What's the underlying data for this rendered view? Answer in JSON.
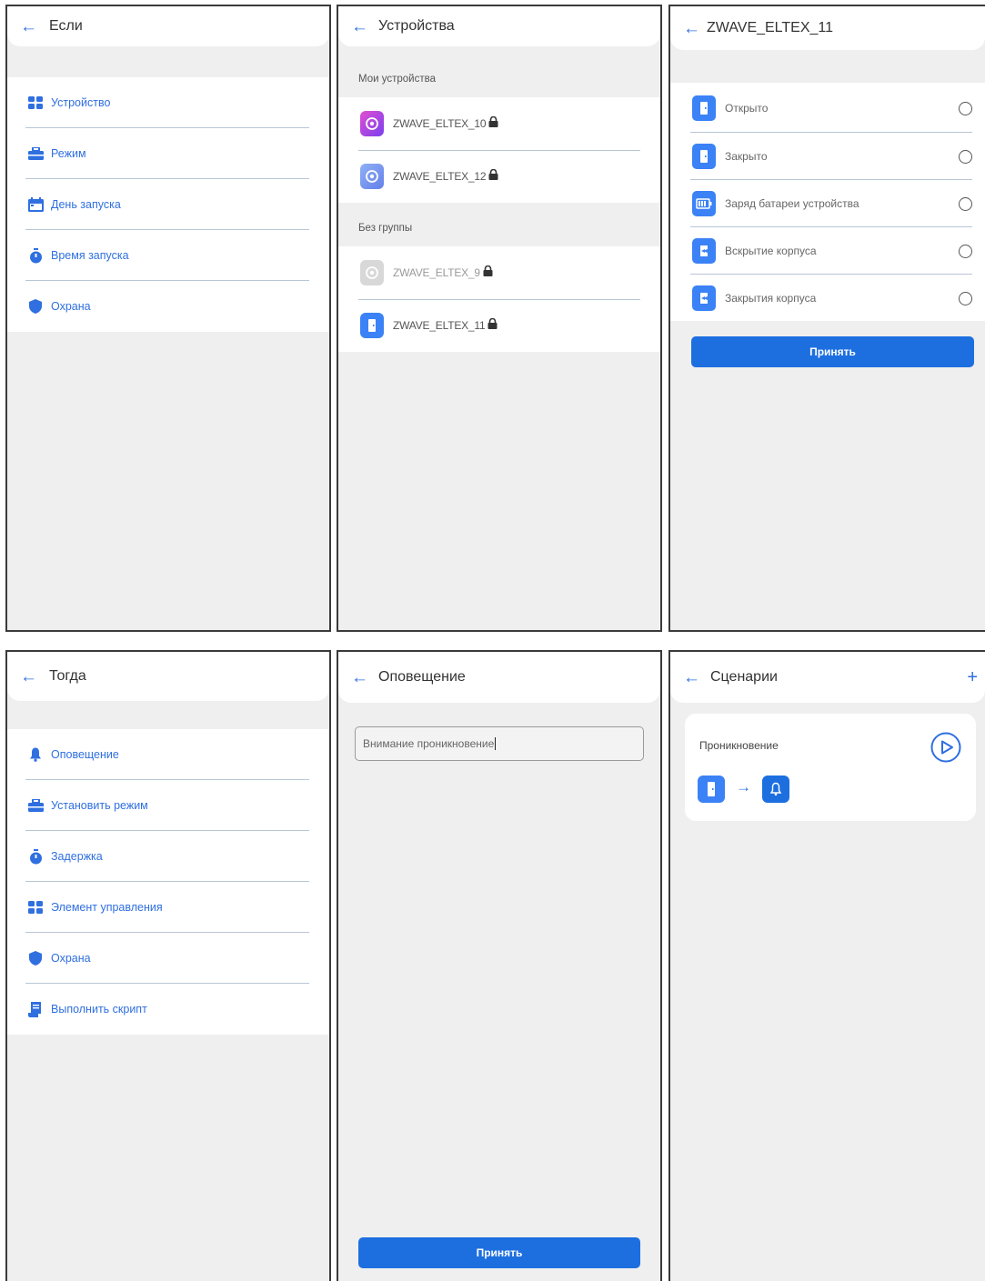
{
  "panels": {
    "if": {
      "back_icon": "arrow-left-icon",
      "title": "Если",
      "items": [
        {
          "label": "Устройство",
          "icon": "grid-icon"
        },
        {
          "label": "Режим",
          "icon": "briefcase-icon"
        },
        {
          "label": "День запуска",
          "icon": "calendar-icon"
        },
        {
          "label": "Время запуска",
          "icon": "stopwatch-icon"
        },
        {
          "label": "Охрана",
          "icon": "shield-icon"
        }
      ]
    },
    "devices": {
      "title": "Устройства",
      "section_mine": "Мои устройства",
      "section_nogroup": "Без группы",
      "mine": [
        {
          "name": "ZWAVE_ELTEX_10",
          "icon": "sensor-icon",
          "color": "#9b3fe6"
        },
        {
          "name": "ZWAVE_ELTEX_12",
          "icon": "sensor-icon",
          "color": "#6e8ff0"
        }
      ],
      "nogroup": [
        {
          "name": "ZWAVE_ELTEX_9",
          "icon": "sensor-icon",
          "color": "#cfcfcf"
        },
        {
          "name": "ZWAVE_ELTEX_11",
          "icon": "door-icon",
          "color": "#3b82f6"
        }
      ]
    },
    "device_detail": {
      "title": "ZWAVE_ELTEX_11",
      "options": [
        {
          "label": "Открыто",
          "icon": "door-icon"
        },
        {
          "label": "Закрыто",
          "icon": "door-icon"
        },
        {
          "label": "Заряд батареи устройства",
          "icon": "battery-icon"
        },
        {
          "label": "Вскрытие корпуса",
          "icon": "tamper-icon"
        },
        {
          "label": "Закрытия корпуса",
          "icon": "tamper-icon"
        }
      ],
      "accept": "Принять"
    },
    "then": {
      "title": "Тогда",
      "items": [
        {
          "label": "Оповещение",
          "icon": "bell-icon"
        },
        {
          "label": "Установить режим",
          "icon": "briefcase-icon"
        },
        {
          "label": "Задержка",
          "icon": "stopwatch-icon"
        },
        {
          "label": "Элемент управления",
          "icon": "grid-icon"
        },
        {
          "label": "Охрана",
          "icon": "shield-icon"
        },
        {
          "label": "Выполнить скрипт",
          "icon": "script-icon"
        }
      ]
    },
    "notification": {
      "title": "Оповещение",
      "input_value": "Внимание проникновение",
      "accept": "Принять"
    },
    "scenarios": {
      "title": "Сценарии",
      "add_icon": "plus-icon",
      "card_title": "Проникновение",
      "play_icon": "play-circle-icon",
      "flow": [
        "door-icon",
        "arrow-right-icon",
        "bell-icon"
      ]
    }
  },
  "colors": {
    "accent": "#2f6fe0",
    "button": "#1d6fe0",
    "panel_bg": "#efefef",
    "border": "#3a3a3a"
  }
}
